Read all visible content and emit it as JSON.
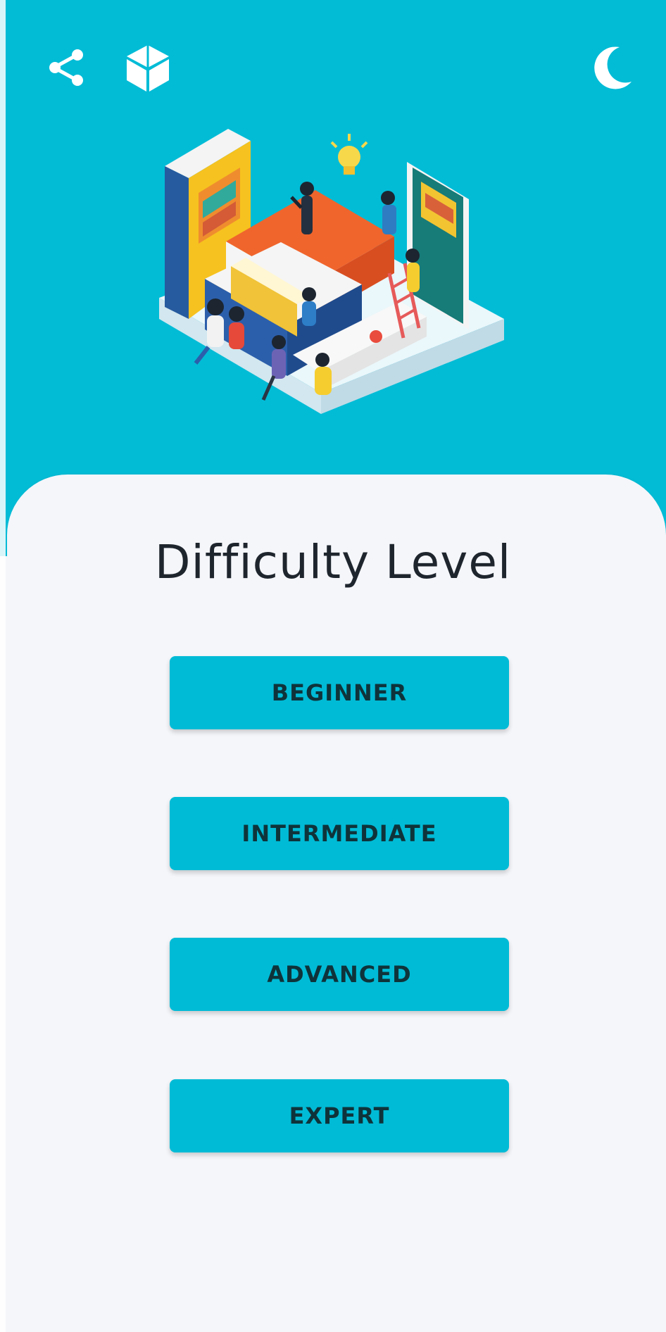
{
  "app": {
    "title": "Difficulty Level"
  },
  "toolbar": {
    "share_icon": "share-icon",
    "cube_icon": "cube-icon",
    "theme_icon": "moon-icon"
  },
  "illustration": {
    "name": "library-study-illustration"
  },
  "levels": {
    "beginner": "BEGINNER",
    "intermediate": "INTERMEDIATE",
    "advanced": "ADVANCED",
    "expert": "EXPERT"
  },
  "colors": {
    "primary": "#02bcd6",
    "background": "#f4f6fa",
    "title_text": "#1f252d",
    "button_text": "#0f333a"
  }
}
